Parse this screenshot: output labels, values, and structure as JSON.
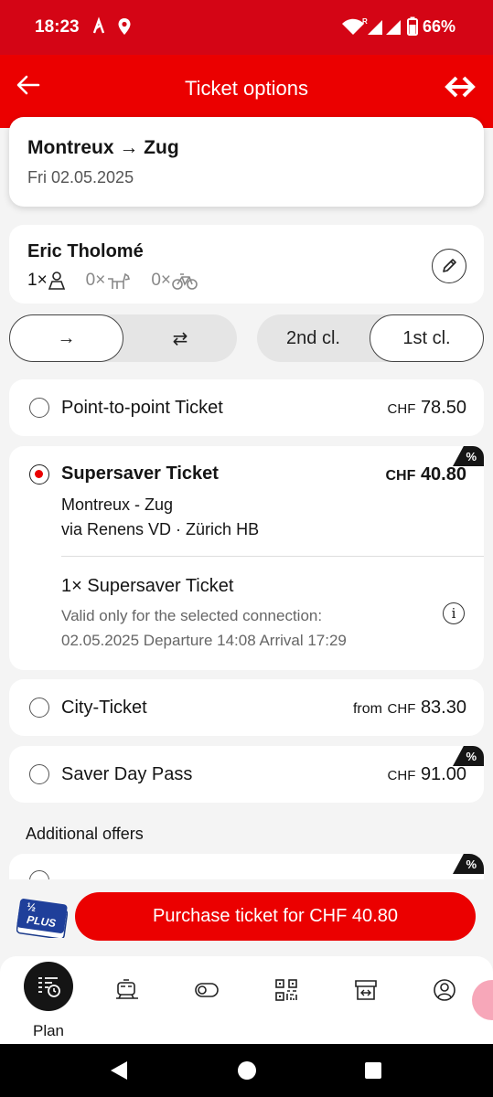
{
  "status_bar": {
    "time": "18:23",
    "battery": "66%"
  },
  "app_bar": {
    "title": "Ticket options"
  },
  "journey": {
    "route": "Montreux → Zug",
    "date": "Fri 02.05.2025"
  },
  "traveller": {
    "name": "Eric Tholomé",
    "adults": "1×",
    "dogs": "0×",
    "bikes": "0×"
  },
  "direction_toggle": {
    "options": [
      "→",
      "⇄"
    ],
    "selected": "→"
  },
  "class_toggle": {
    "options": [
      "2nd cl.",
      "1st cl."
    ],
    "selected": "1st cl."
  },
  "ticket_options": [
    {
      "label": "Point-to-point Ticket",
      "currency": "CHF",
      "price": "78.50",
      "selected": false
    },
    {
      "label": "Supersaver Ticket",
      "currency": "CHF",
      "price": "40.80",
      "selected": true,
      "badge": "%",
      "route": "Montreux - Zug",
      "via": "via Renens VD · Zürich HB",
      "detail_title": "1× Supersaver Ticket",
      "validity": "Valid only for the selected connection:",
      "times": "02.05.2025 Departure 14:08 Arrival 17:29"
    },
    {
      "label": "City-Ticket",
      "prefix": "from",
      "currency": "CHF",
      "price": "83.30",
      "selected": false
    },
    {
      "label": "Saver Day Pass",
      "currency": "CHF",
      "price": "91.00",
      "selected": false,
      "badge": "%"
    }
  ],
  "additional_offers": {
    "title": "Additional offers",
    "badge": "%"
  },
  "purchase": {
    "halffare_text": "PLUS",
    "halffare_fraction": "½",
    "button_label": "Purchase ticket for CHF 40.80"
  },
  "bottom_nav": {
    "plan_label": "Plan",
    "items": [
      "plan-icon",
      "train-icon",
      "toggle-icon",
      "qr-code-icon",
      "shop-icon",
      "profile-icon"
    ]
  },
  "colors": {
    "brand_red": "#eb0000",
    "status_red": "#d40515",
    "background": "#f4f4f4"
  }
}
